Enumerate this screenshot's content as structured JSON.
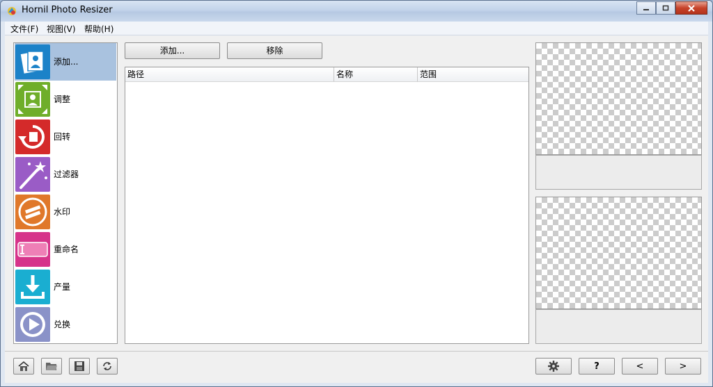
{
  "window": {
    "title": "Hornil Photo Resizer"
  },
  "menu": [
    {
      "label": "文件(F)"
    },
    {
      "label": "视图(V)"
    },
    {
      "label": "帮助(H)"
    }
  ],
  "sidebar": {
    "items": [
      {
        "label": "添加...",
        "icon": "add-photo-icon",
        "color": "#1c82c8"
      },
      {
        "label": "调整",
        "icon": "resize-icon",
        "color": "#6fae2a"
      },
      {
        "label": "回转",
        "icon": "rotate-icon",
        "color": "#d42a2a"
      },
      {
        "label": "过滤器",
        "icon": "magic-wand-icon",
        "color": "#9a5cc6"
      },
      {
        "label": "水印",
        "icon": "watermark-icon",
        "color": "#e0782a"
      },
      {
        "label": "重命名",
        "icon": "rename-icon",
        "color": "#d6338a"
      },
      {
        "label": "产量",
        "icon": "output-download-icon",
        "color": "#1aaed1"
      },
      {
        "label": "兑换",
        "icon": "convert-play-icon",
        "color": "#8a92c8"
      }
    ]
  },
  "toolbar": {
    "add_label": "添加...",
    "remove_label": "移除"
  },
  "table": {
    "columns": [
      "路径",
      "名称",
      "范围"
    ],
    "rows": []
  },
  "bottom": {
    "left_buttons": [
      "home-icon",
      "open-folder-icon",
      "save-icon",
      "refresh-icon"
    ],
    "help_label": "?",
    "prev_label": "<",
    "next_label": ">"
  }
}
